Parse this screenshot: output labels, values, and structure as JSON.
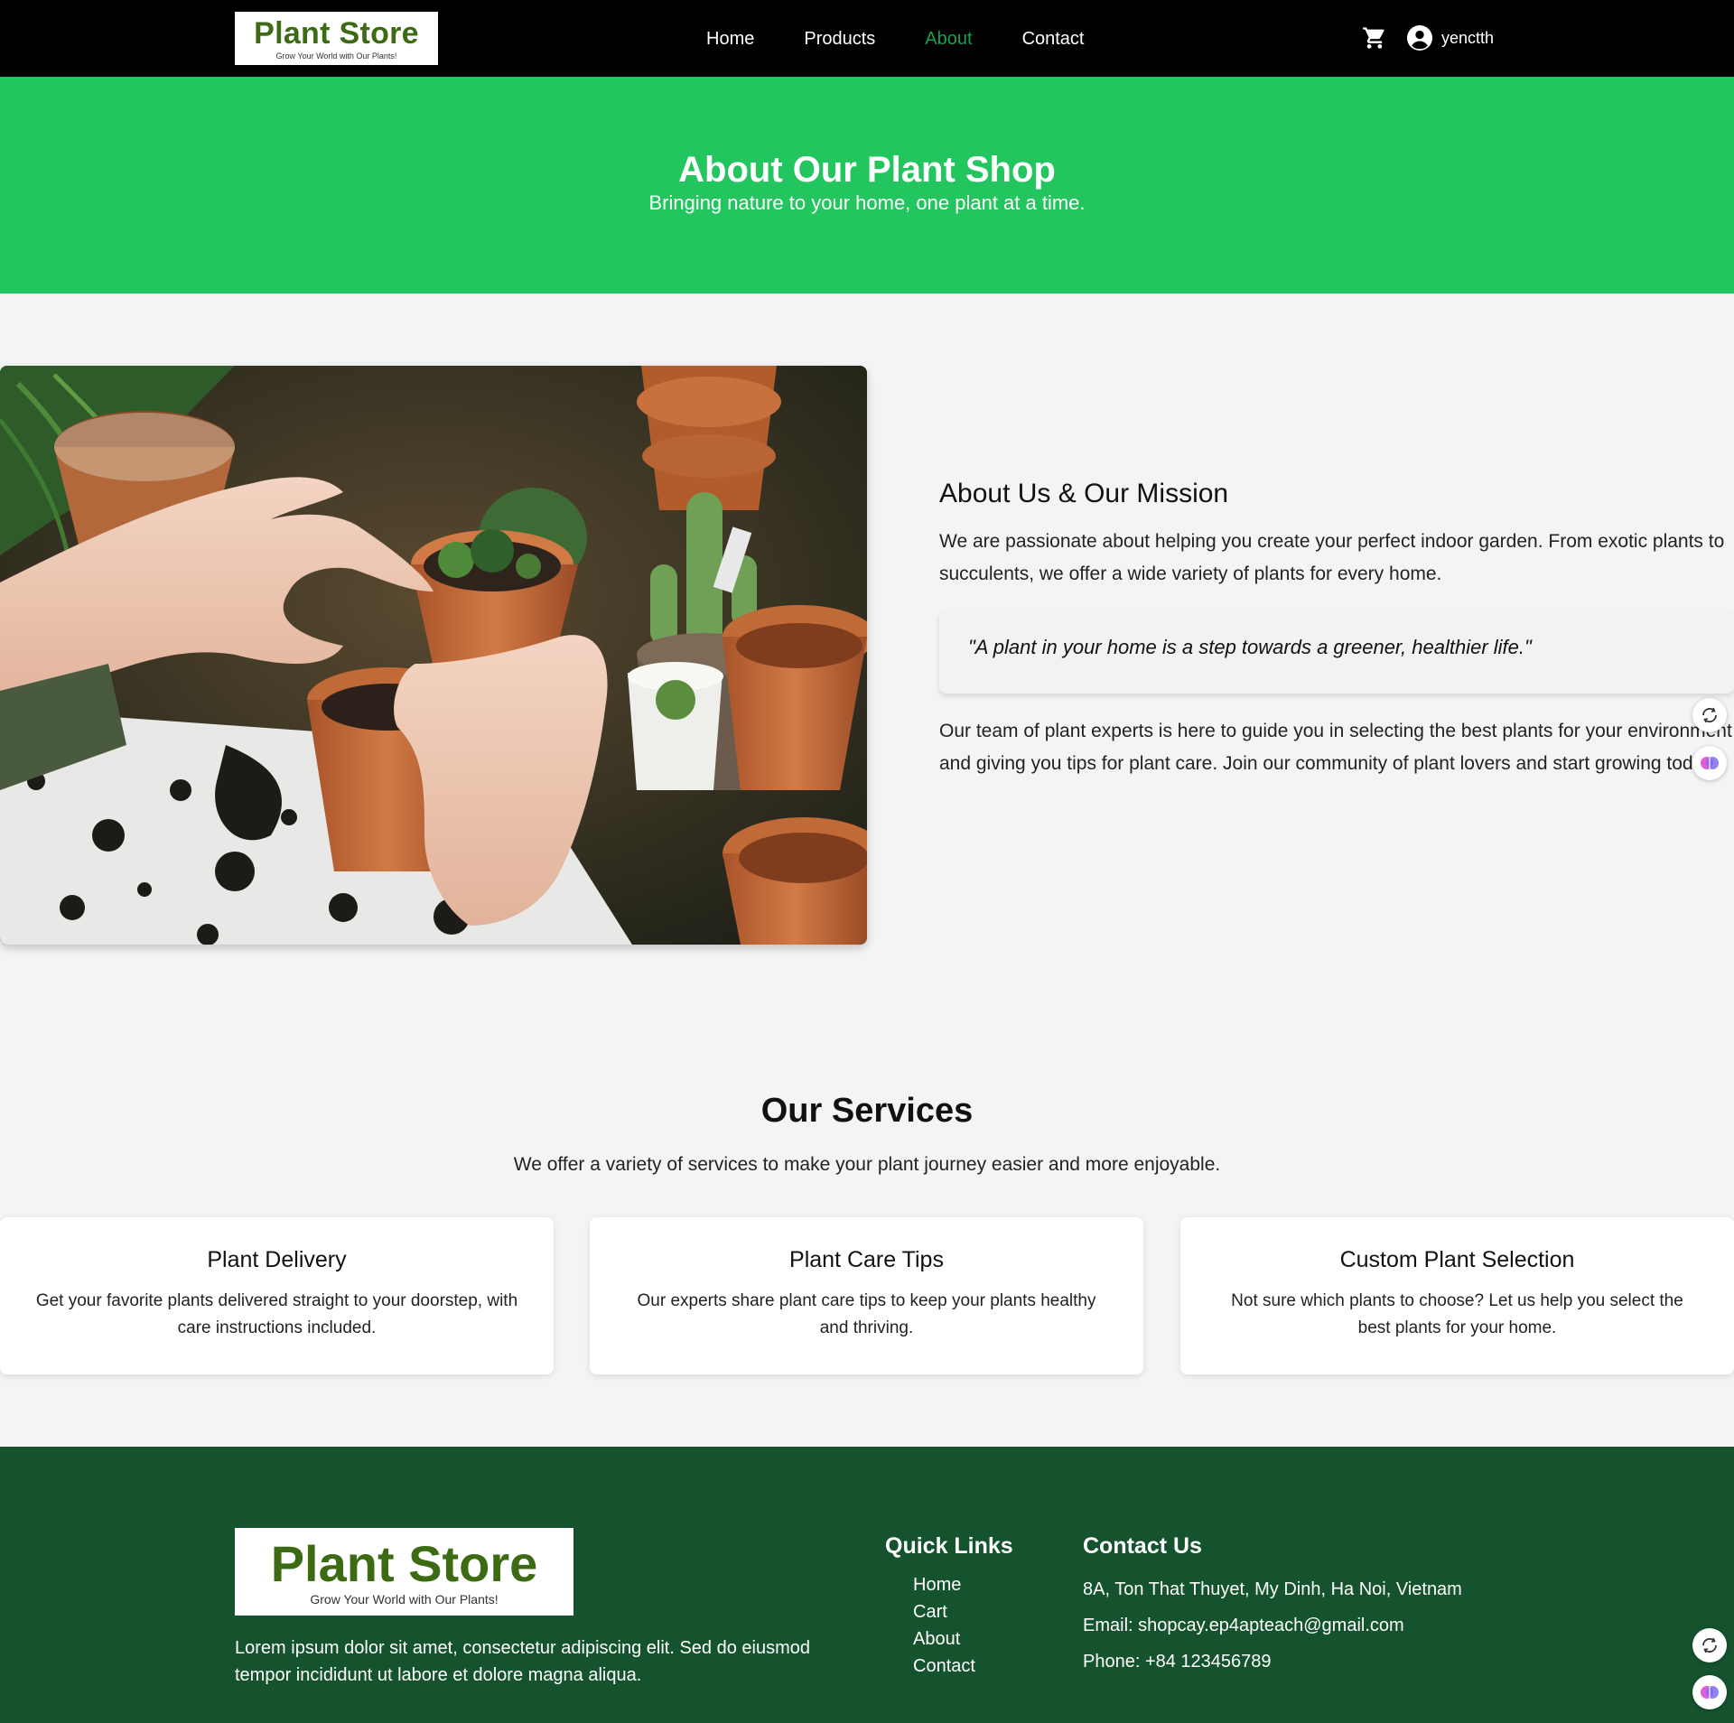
{
  "brand": {
    "name": "Plant Store",
    "tagline": "Grow Your World with Our Plants!",
    "color": "#3d6b13"
  },
  "nav": {
    "links": [
      {
        "label": "Home",
        "active": false
      },
      {
        "label": "Products",
        "active": false
      },
      {
        "label": "About",
        "active": true
      },
      {
        "label": "Contact",
        "active": false
      }
    ],
    "active_color": "#16a34a",
    "username": "yenctth",
    "icons": [
      "cart-icon",
      "user-circle-icon"
    ]
  },
  "hero": {
    "title": "About Our Plant Shop",
    "subtitle": "Bringing nature to your home, one plant at a time.",
    "bg_color": "#22c55e"
  },
  "about": {
    "heading": "About Us & Our Mission",
    "paragraph1": "We are passionate about helping you create your perfect indoor garden. From exotic plants to succulents, we offer a wide variety of plants for every home.",
    "quote": "\"A plant in your home is a step towards a greener, healthier life.\"",
    "paragraph2": "Our team of plant experts is here to guide you in selecting the best plants for your environment and giving you tips for plant care. Join our community of plant lovers and start growing today!"
  },
  "services": {
    "title": "Our Services",
    "subtitle": "We offer a variety of services to make your plant journey easier and more enjoyable.",
    "items": [
      {
        "title": "Plant Delivery",
        "text": "Get your favorite plants delivered straight to your doorstep, with care instructions included."
      },
      {
        "title": "Plant Care Tips",
        "text": "Our experts share plant care tips to keep your plants healthy and thriving."
      },
      {
        "title": "Custom Plant Selection",
        "text": "Not sure which plants to choose? Let us help you select the best plants for your home."
      }
    ]
  },
  "footer": {
    "description": "Lorem ipsum dolor sit amet, consectetur adipiscing elit. Sed do eiusmod tempor incididunt ut labore et dolore magna aliqua.",
    "quick_links_title": "Quick Links",
    "quick_links": [
      "Home",
      "Cart",
      "About",
      "Contact"
    ],
    "contact_title": "Contact Us",
    "address": "8A, Ton That Thuyet, My Dinh, Ha Noi, Vietnam",
    "email": "Email: shopcay.ep4apteach@gmail.com",
    "phone": "Phone: +84 123456789",
    "bg_color": "#14532d"
  },
  "widgets": [
    "translate-icon",
    "ai-brain-icon"
  ]
}
